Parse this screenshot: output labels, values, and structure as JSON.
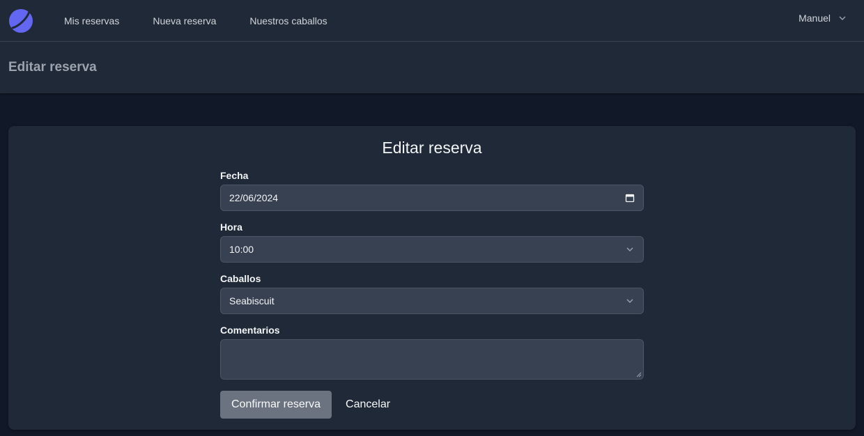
{
  "nav": {
    "links": [
      {
        "label": "Mis reservas"
      },
      {
        "label": "Nueva reserva"
      },
      {
        "label": "Nuestros caballos"
      }
    ],
    "user": "Manuel",
    "logo_icon": "crescent-logo-icon",
    "accent": "#6366f1"
  },
  "page_header": {
    "title": "Editar reserva"
  },
  "form": {
    "title": "Editar reserva",
    "fecha": {
      "label": "Fecha",
      "value": "22/06/2024",
      "icon": "calendar-icon"
    },
    "hora": {
      "label": "Hora",
      "value": "10:00",
      "icon": "chevron-down-icon"
    },
    "caballos": {
      "label": "Caballos",
      "value": "Seabiscuit",
      "icon": "chevron-down-icon"
    },
    "comentarios": {
      "label": "Comentarios",
      "value": ""
    },
    "submit_label": "Confirmar reserva",
    "cancel_label": "Cancelar"
  }
}
